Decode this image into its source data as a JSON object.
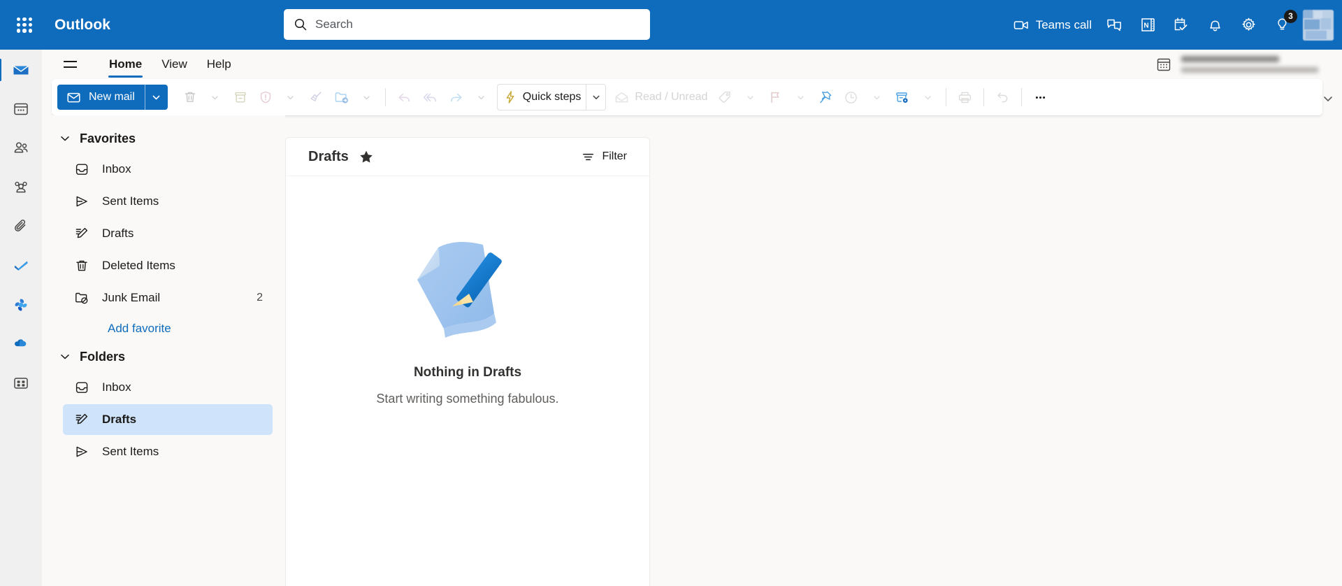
{
  "app": {
    "brand": "Outlook",
    "waffle_icon": "app-launcher-grid-icon"
  },
  "search": {
    "placeholder": "Search",
    "value": "",
    "icon": "search-icon"
  },
  "topbar": {
    "teams_call": {
      "label": "Teams call",
      "icon": "video-camera-icon"
    },
    "items": [
      {
        "name": "chat",
        "icon": "chat-bubbles-icon"
      },
      {
        "name": "onenote",
        "icon": "onenote-icon"
      },
      {
        "name": "my-day",
        "icon": "calendar-check-icon"
      },
      {
        "name": "notifications",
        "icon": "bell-icon"
      },
      {
        "name": "settings",
        "icon": "gear-icon"
      },
      {
        "name": "tips",
        "icon": "lightbulb-icon",
        "badge": "3"
      }
    ],
    "account_avatar": "user-avatar"
  },
  "rail": {
    "items": [
      {
        "name": "mail",
        "icon": "envelope-icon",
        "active": true
      },
      {
        "name": "calendar",
        "icon": "calendar-icon",
        "active": false
      },
      {
        "name": "people",
        "icon": "people-icon",
        "active": false
      },
      {
        "name": "groups",
        "icon": "groups-icon",
        "active": false
      },
      {
        "name": "files",
        "icon": "paperclip-icon",
        "active": false
      },
      {
        "name": "to-do",
        "icon": "checkmark-icon",
        "active": false
      },
      {
        "name": "loop",
        "icon": "loop-icon",
        "active": false
      },
      {
        "name": "onedrive",
        "icon": "onedrive-cloud-icon",
        "active": false
      },
      {
        "name": "more-apps",
        "icon": "apps-grid-icon",
        "active": false
      }
    ]
  },
  "ribbon": {
    "hamburger_icon": "hamburger-menu-icon",
    "tabs": [
      {
        "label": "Home",
        "active": true
      },
      {
        "label": "View",
        "active": false
      },
      {
        "label": "Help",
        "active": false
      }
    ],
    "account_calendar_icon": "calendar-month-icon",
    "new_mail": {
      "label": "New mail",
      "icon": "envelope-icon",
      "caret": "chevron-down-icon"
    },
    "commands": [
      {
        "name": "delete",
        "icon": "trash-icon",
        "has_caret": true,
        "disabled": true
      },
      {
        "name": "archive",
        "icon": "archive-box-icon",
        "has_caret": false,
        "disabled": true
      },
      {
        "name": "report-junk",
        "icon": "shield-alert-icon",
        "has_caret": true,
        "disabled": true
      },
      {
        "name": "sweep",
        "icon": "broom-icon",
        "has_caret": false,
        "disabled": true
      },
      {
        "name": "move-to",
        "icon": "folder-arrow-icon",
        "has_caret": true,
        "disabled": true
      },
      {
        "name": "reply",
        "icon": "reply-arrow-icon",
        "has_caret": false,
        "disabled": true
      },
      {
        "name": "reply-all",
        "icon": "reply-all-arrow-icon",
        "has_caret": false,
        "disabled": true
      },
      {
        "name": "forward",
        "icon": "forward-arrow-icon",
        "has_caret": true,
        "disabled": true
      }
    ],
    "quick_steps": {
      "label": "Quick steps",
      "icon": "lightning-bolt-icon",
      "caret": "chevron-down-icon"
    },
    "read_unread": {
      "label": "Read / Unread",
      "icon": "open-envelope-icon",
      "disabled": true
    },
    "commands2": [
      {
        "name": "categorize",
        "icon": "tag-icon",
        "has_caret": true,
        "disabled": true
      },
      {
        "name": "flag",
        "icon": "flag-icon",
        "has_caret": true,
        "disabled": true
      },
      {
        "name": "pin",
        "icon": "pin-icon",
        "has_caret": false,
        "disabled": false
      },
      {
        "name": "snooze",
        "icon": "clock-icon",
        "has_caret": true,
        "disabled": true
      },
      {
        "name": "rules",
        "icon": "rules-gear-icon",
        "has_caret": true,
        "disabled": false
      },
      {
        "name": "print",
        "icon": "printer-icon",
        "has_caret": false,
        "disabled": true
      },
      {
        "name": "undo",
        "icon": "undo-arrow-icon",
        "has_caret": false,
        "disabled": true
      },
      {
        "name": "more-options",
        "icon": "ellipsis-icon",
        "has_caret": false,
        "disabled": false
      }
    ],
    "collapse_icon": "chevron-down-icon"
  },
  "folder_pane": {
    "favorites": {
      "title": "Favorites",
      "chevron": "chevron-down-icon",
      "items": [
        {
          "label": "Inbox",
          "icon": "inbox-icon",
          "count": "",
          "selected": false
        },
        {
          "label": "Sent Items",
          "icon": "send-icon",
          "count": "",
          "selected": false
        },
        {
          "label": "Drafts",
          "icon": "draft-pencil-icon",
          "count": "",
          "selected": false
        },
        {
          "label": "Deleted Items",
          "icon": "trash-icon",
          "count": "",
          "selected": false
        },
        {
          "label": "Junk Email",
          "icon": "junk-folder-icon",
          "count": "2",
          "selected": false
        }
      ],
      "add_favorite": "Add favorite"
    },
    "folders": {
      "title": "Folders",
      "chevron": "chevron-down-icon",
      "items": [
        {
          "label": "Inbox",
          "icon": "inbox-icon",
          "count": "",
          "selected": false
        },
        {
          "label": "Drafts",
          "icon": "draft-pencil-icon",
          "count": "",
          "selected": true
        },
        {
          "label": "Sent Items",
          "icon": "send-icon",
          "count": "",
          "selected": false
        }
      ]
    }
  },
  "message_list": {
    "title": "Drafts",
    "favorite_icon": "star-filled-icon",
    "filter": {
      "label": "Filter",
      "icon": "filter-lines-icon"
    },
    "empty_state": {
      "illustration": "paper-and-pencil-illustration",
      "title": "Nothing in Drafts",
      "subtitle": "Start writing something fabulous."
    }
  },
  "colors": {
    "brand_blue": "#0f6cbd",
    "selected_folder": "#cfe4fa",
    "rail_bg": "#f0f0f0",
    "surface": "#faf9f8"
  }
}
